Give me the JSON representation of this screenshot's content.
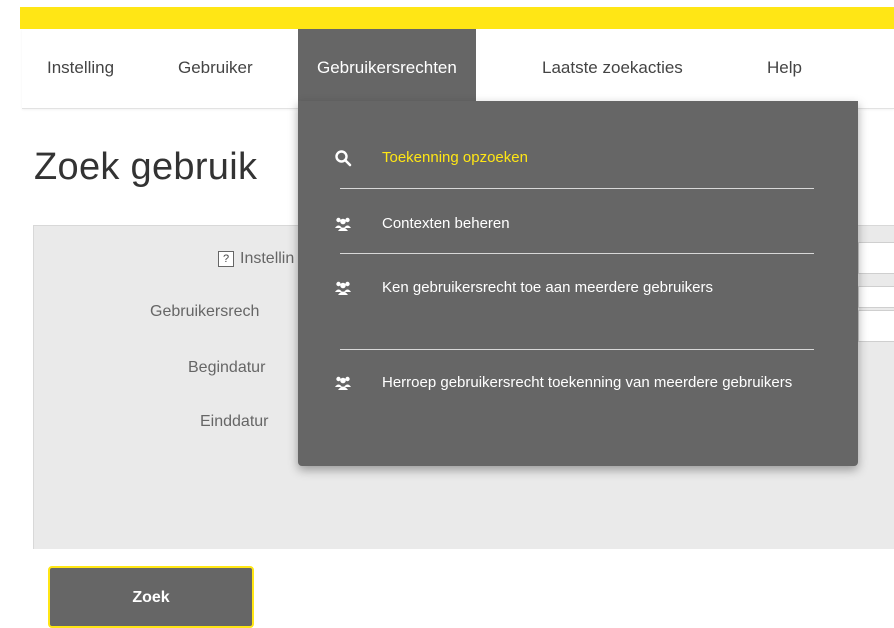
{
  "nav": {
    "items": [
      {
        "label": "Instelling"
      },
      {
        "label": "Gebruiker"
      },
      {
        "label": "Gebruikersrechten"
      },
      {
        "label": "Laatste zoekacties"
      },
      {
        "label": "Help"
      }
    ],
    "active_index": 2
  },
  "page": {
    "title": "Zoek gebruik"
  },
  "form": {
    "help_glyph": "?",
    "labels": {
      "instelling": "Instellin",
      "gebruikersrecht": "Gebruikersrech",
      "begindatum": "Begindatur",
      "einddatum": "Einddatur"
    },
    "submit_label": "Zoek"
  },
  "dropdown": {
    "items": [
      {
        "label": "Toekenning opzoeken",
        "icon": "search-icon",
        "highlighted": true
      },
      {
        "label": "Contexten beheren",
        "icon": "group-icon"
      },
      {
        "label": "Ken gebruikersrecht toe aan meerdere gebruikers",
        "icon": "group-icon"
      },
      {
        "label": "Herroep gebruikersrecht toekenning van meerdere gebruikers",
        "icon": "group-icon"
      }
    ]
  },
  "colors": {
    "accent_yellow": "#ffe615",
    "menu_gray": "#666666",
    "panel_gray": "#eaeaea"
  }
}
